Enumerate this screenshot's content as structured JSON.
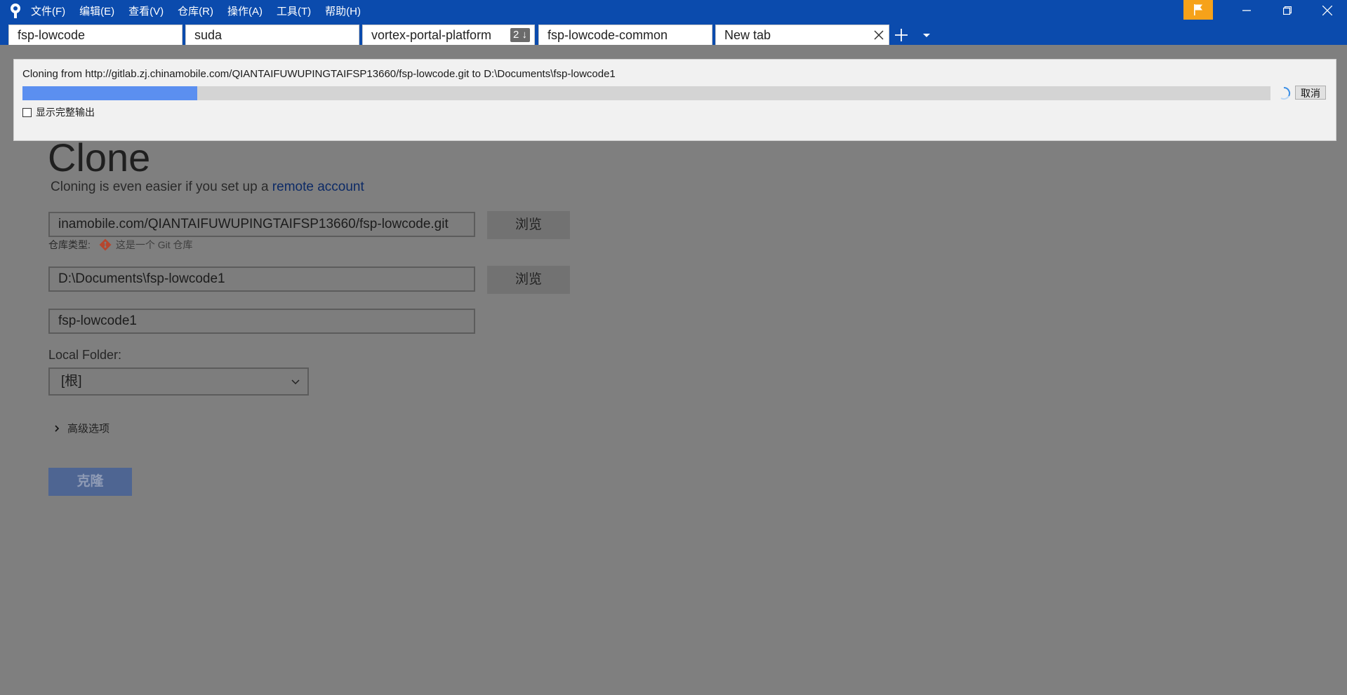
{
  "menu": {
    "items": [
      "文件(F)",
      "编辑(E)",
      "查看(V)",
      "仓库(R)",
      "操作(A)",
      "工具(T)",
      "帮助(H)"
    ]
  },
  "tabs": [
    {
      "label": "fsp-lowcode"
    },
    {
      "label": "suda"
    },
    {
      "label": "vortex-portal-platform",
      "badge": "2 ↓"
    },
    {
      "label": "fsp-lowcode-common"
    },
    {
      "label": "New tab",
      "active": true
    }
  ],
  "progress": {
    "message": "Cloning from http://gitlab.zj.chinamobile.com/QIANTAIFUWUPINGTAIFSP13660/fsp-lowcode.git to D:\\Documents\\fsp-lowcode1",
    "fraction": 0.14,
    "cancel_label": "取消",
    "show_output_label": "显示完整输出"
  },
  "clone": {
    "title": "Clone",
    "subtitle_prefix": "Cloning is even easier if you set up a ",
    "subtitle_link": "remote account",
    "source_value": "inamobile.com/QIANTAIFUWUPINGTAIFSP13660/fsp-lowcode.git",
    "browse_label": "浏览",
    "repo_type_label": "仓库类型:",
    "repo_type_value": "这是一个 Git 仓库",
    "dest_value": "D:\\Documents\\fsp-lowcode1",
    "name_value": "fsp-lowcode1",
    "local_folder_label": "Local Folder:",
    "local_folder_value": "[根]",
    "advanced_label": "高级选项",
    "clone_button": "克隆"
  },
  "colors": {
    "titlebar": "#0b4bad",
    "flag": "#f6a21a",
    "progress_fill": "#5b8ff0",
    "overlay": "#7f7f7f"
  },
  "icons": [
    "sourcetree-logo-icon",
    "flag-icon",
    "minimize-icon",
    "restore-icon",
    "close-icon",
    "plus-icon",
    "chevron-down-icon",
    "git-icon",
    "chevron-right-icon",
    "spinner-icon"
  ]
}
